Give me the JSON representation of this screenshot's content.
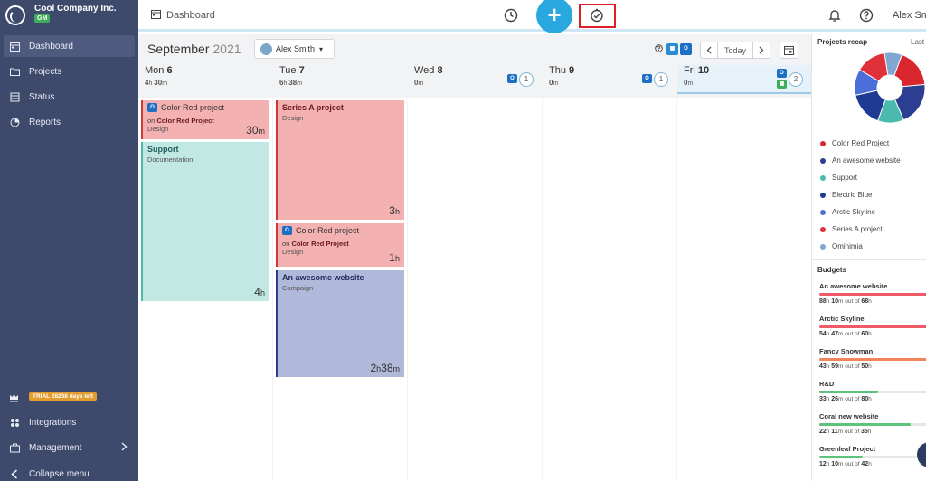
{
  "brand": {
    "company": "Cool Company Inc.",
    "badge": "GM"
  },
  "sidebar": {
    "items": [
      {
        "label": "Dashboard",
        "icon": "calendar-icon",
        "active": true
      },
      {
        "label": "Projects",
        "icon": "folder-icon"
      },
      {
        "label": "Status",
        "icon": "status-icon"
      },
      {
        "label": "Reports",
        "icon": "pie-icon"
      }
    ],
    "trial": "TRIAL 28238 days left",
    "bottom_items": [
      {
        "label": "Integrations",
        "icon": "integrations-icon"
      },
      {
        "label": "Management",
        "icon": "briefcase-icon"
      },
      {
        "label": "Collapse menu",
        "icon": "chevron-left-icon"
      }
    ]
  },
  "topbar": {
    "breadcrumb": "Dashboard",
    "user": "Alex Smi"
  },
  "calendar": {
    "month": "September",
    "year": "2021",
    "user_select": "Alex Smith",
    "today_label": "Today",
    "days": [
      {
        "name": "Mon",
        "num": "6",
        "total_h": "4",
        "total_m": "30"
      },
      {
        "name": "Tue",
        "num": "7",
        "total_h": "6",
        "total_m": "38"
      },
      {
        "name": "Wed",
        "num": "8",
        "total_m": "0",
        "count": "1"
      },
      {
        "name": "Thu",
        "num": "9",
        "total_m": "0",
        "count": "1"
      },
      {
        "name": "Fri",
        "num": "10",
        "total_m": "0",
        "count": "2"
      }
    ],
    "events": {
      "mon1": {
        "title": "Color Red project",
        "on": "on",
        "project": "Color Red Project",
        "sub": "Design",
        "dur_num": "30",
        "dur_unit": "m"
      },
      "mon2": {
        "title": "Support",
        "sub": "Documentation",
        "dur_num": "4",
        "dur_unit": "h"
      },
      "tue1": {
        "title": "Series A project",
        "sub": "Design",
        "dur_num": "3",
        "dur_unit": "h"
      },
      "tue2": {
        "title": "Color Red project",
        "on": "on",
        "project": "Color Red Project",
        "sub": "Design",
        "dur_num": "1",
        "dur_unit": "h"
      },
      "tue3": {
        "title": "An awesome website",
        "sub": "Campaign",
        "dur_num": "2",
        "dur_unit": "h",
        "dur_num2": "38",
        "dur_unit2": "m"
      }
    }
  },
  "recap": {
    "title": "Projects recap",
    "last": "Last",
    "legend": [
      {
        "label": "Color Red Project",
        "color": "#d9262f"
      },
      {
        "label": "An awesome website",
        "color": "#2c3e8f"
      },
      {
        "label": "Support",
        "color": "#4ab9ae"
      },
      {
        "label": "Electric Blue",
        "color": "#1f3a93"
      },
      {
        "label": "Arctic Skyline",
        "color": "#4a6fd9"
      },
      {
        "label": "Series A project",
        "color": "#e0303a"
      },
      {
        "label": "Ominimia",
        "color": "#7fa7d0"
      }
    ]
  },
  "budgets": {
    "title": "Budgets",
    "items": [
      {
        "name": "An awesome website",
        "h": "88",
        "m": "10",
        "of": "out of",
        "total_h": "68",
        "color": "#ef5b66",
        "fill": 1.0
      },
      {
        "name": "Arctic Skyline",
        "h": "54",
        "m": "47",
        "of": "out of",
        "total_h": "60",
        "color": "#ef5b66",
        "fill": 1.0
      },
      {
        "name": "Fancy Snowman",
        "h": "43",
        "m": "59",
        "of": "out of",
        "total_h": "50",
        "color": "#f0845a",
        "fill": 1.0
      },
      {
        "name": "R&D",
        "h": "33",
        "m": "26",
        "of": "out of",
        "total_h": "80",
        "color": "#5bc37a",
        "fill": 0.55
      },
      {
        "name": "Coral new website",
        "h": "22",
        "m": "11",
        "of": "out of",
        "total_h": "35",
        "color": "#5bc37a",
        "fill": 0.85
      },
      {
        "name": "Greenleaf Project",
        "h": "12",
        "m": "10",
        "of": "out of",
        "total_h": "42",
        "color": "#5bc37a",
        "fill": 0.4
      }
    ]
  }
}
